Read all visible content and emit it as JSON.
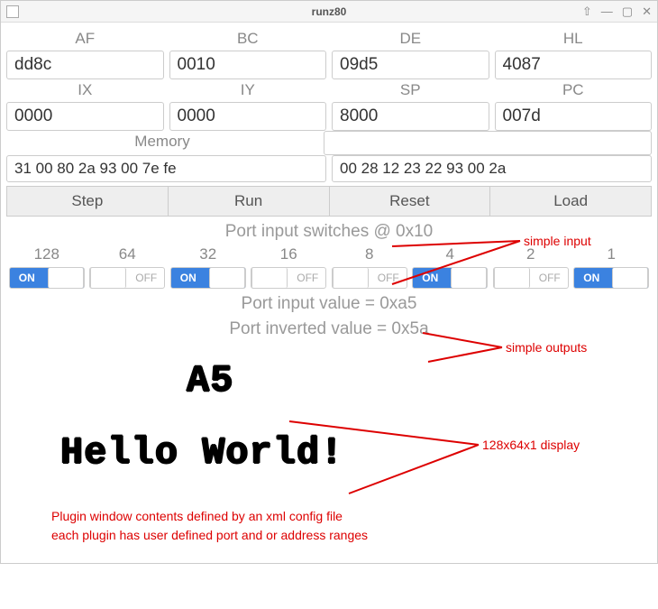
{
  "window": {
    "title": "runz80",
    "btn_pin": "⇧",
    "btn_min": "—",
    "btn_max": "▢",
    "btn_close": "✕"
  },
  "registers1": {
    "AF": {
      "label": "AF",
      "value": "dd8c"
    },
    "BC": {
      "label": "BC",
      "value": "0010"
    },
    "DE": {
      "label": "DE",
      "value": "09d5"
    },
    "HL": {
      "label": "HL",
      "value": "4087"
    }
  },
  "registers2": {
    "IX": {
      "label": "IX",
      "value": "0000"
    },
    "IY": {
      "label": "IY",
      "value": "0000"
    },
    "SP": {
      "label": "SP",
      "value": "8000"
    },
    "PC": {
      "label": "PC",
      "value": "007d"
    }
  },
  "memory": {
    "label": "Memory",
    "addr": "",
    "left": "31 00 80 2a 93 00 7e fe",
    "right": "00 28 12 23 22 93 00 2a"
  },
  "buttons": {
    "step": "Step",
    "run": "Run",
    "reset": "Reset",
    "load": "Load"
  },
  "port_switches": {
    "heading": "Port input switches @ 0x10",
    "bits": [
      {
        "label": "128",
        "on": true
      },
      {
        "label": "64",
        "on": false
      },
      {
        "label": "32",
        "on": true
      },
      {
        "label": "16",
        "on": false
      },
      {
        "label": "8",
        "on": false
      },
      {
        "label": "4",
        "on": true
      },
      {
        "label": "2",
        "on": false
      },
      {
        "label": "1",
        "on": true
      }
    ]
  },
  "port_values": {
    "input": "Port input value = 0xa5",
    "inverted": "Port inverted value = 0x5a"
  },
  "display": {
    "line1": "A5",
    "line2": "Hello World!"
  },
  "annotations": {
    "simple_input": "simple input",
    "simple_outputs": "simple outputs",
    "display_desc": "128x64x1 display",
    "footer1": "Plugin window contents defined by an xml config file",
    "footer2": "each plugin has user defined port and or address ranges"
  }
}
